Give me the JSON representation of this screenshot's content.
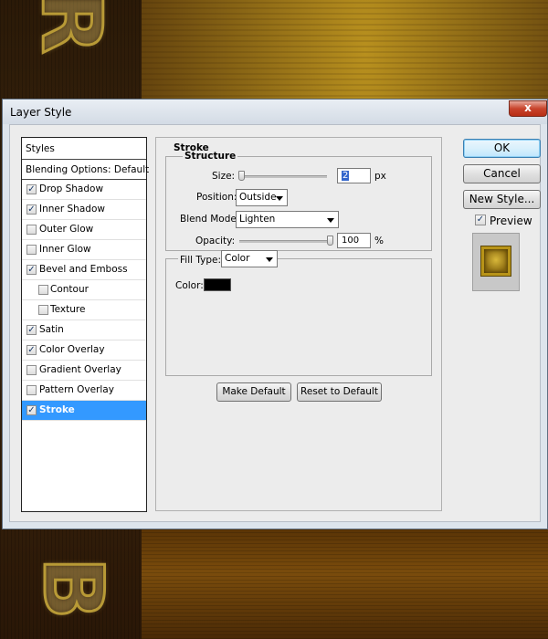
{
  "dialog": {
    "title": "Layer Style",
    "close_glyph": "x"
  },
  "stylelist": {
    "header": "Styles",
    "blending": "Blending Options: Default",
    "items": [
      {
        "label": "Drop Shadow",
        "checked": true,
        "indent": false
      },
      {
        "label": "Inner Shadow",
        "checked": true,
        "indent": false
      },
      {
        "label": "Outer Glow",
        "checked": false,
        "indent": false
      },
      {
        "label": "Inner Glow",
        "checked": false,
        "indent": false
      },
      {
        "label": "Bevel and Emboss",
        "checked": true,
        "indent": false
      },
      {
        "label": "Contour",
        "checked": false,
        "indent": true
      },
      {
        "label": "Texture",
        "checked": false,
        "indent": true
      },
      {
        "label": "Satin",
        "checked": true,
        "indent": false
      },
      {
        "label": "Color Overlay",
        "checked": true,
        "indent": false
      },
      {
        "label": "Gradient Overlay",
        "checked": false,
        "indent": false
      },
      {
        "label": "Pattern Overlay",
        "checked": false,
        "indent": false
      },
      {
        "label": "Stroke",
        "checked": true,
        "indent": false,
        "selected": true
      }
    ],
    "check_glyph": "✓"
  },
  "stroke": {
    "title": "Stroke",
    "structure_title": "Structure",
    "size_label": "Size:",
    "size_value": "2",
    "size_unit": "px",
    "position_label": "Position:",
    "position_value": "Outside",
    "blend_label": "Blend Mode:",
    "blend_value": "Lighten",
    "opacity_label": "Opacity:",
    "opacity_value": "100",
    "opacity_unit": "%",
    "opacity_fraction": 1.0,
    "size_fraction": 0.0,
    "fill_type_label": "Fill Type:",
    "fill_type_value": "Color",
    "color_label": "Color:",
    "color_value": "#000000",
    "make_default": "Make Default",
    "reset_default": "Reset to Default"
  },
  "actions": {
    "ok": "OK",
    "cancel": "Cancel",
    "new_style": "New Style...",
    "preview_label": "Preview",
    "preview_checked": true
  },
  "background": {
    "letter_top": "R",
    "letter_bottom": "B"
  }
}
